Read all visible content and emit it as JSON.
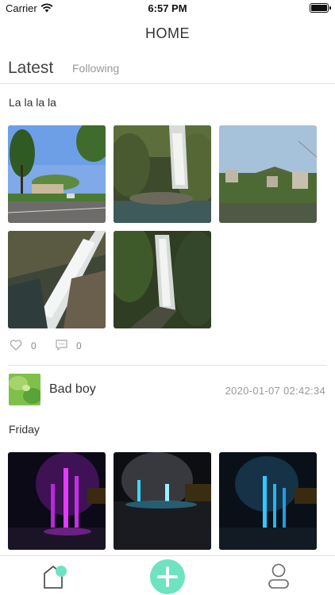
{
  "status_bar": {
    "carrier": "Carrier",
    "time": "6:57 PM"
  },
  "nav": {
    "title": "HOME"
  },
  "tabs": {
    "latest": "Latest",
    "following": "Following"
  },
  "posts": [
    {
      "text": "La la la la",
      "photos": [
        "street-trees-photo",
        "waterfall-photo",
        "lake-village-photo",
        "rock-waterfall-photo",
        "forest-waterfall-photo"
      ],
      "likes": "0",
      "comments": "0"
    },
    {
      "username": "Bad boy",
      "timestamp": "2020-01-07 02:42:34",
      "text": "Friday",
      "photos": [
        "purple-fountain-photo",
        "blue-white-fountain-photo",
        "blue-fountain-photo"
      ]
    }
  ],
  "colors": {
    "accent": "#6ee3c1",
    "divider": "#e2e2e2",
    "muted_text": "#999999"
  },
  "tabbar": {
    "items": [
      "home-icon",
      "add-icon",
      "profile-icon"
    ]
  }
}
